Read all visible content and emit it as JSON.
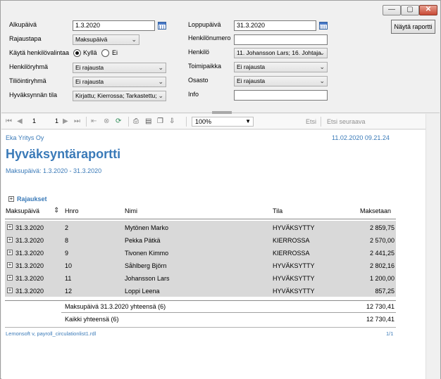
{
  "window": {
    "minimize_glyph": "—",
    "maximize_glyph": "▢",
    "close_glyph": "✕"
  },
  "params": {
    "alkupaiva_label": "Alkupäivä",
    "alkupaiva_value": "1.3.2020",
    "loppupaiva_label": "Loppupäivä",
    "loppupaiva_value": "31.3.2020",
    "rajaustapa_label": "Rajaustapa",
    "rajaustapa_value": "Maksupäivä",
    "henkilonumero_label": "Henkilönumero",
    "henkilonumero_value": "",
    "kayta_label": "Käytä henkilövalintaa",
    "kylla_label": "Kyllä",
    "ei_label": "Ei",
    "henkilo_label": "Henkilö",
    "henkilo_value": "11. Johansson Lars; 16. Johtaja",
    "henkiloryhma_label": "Henkilöryhmä",
    "henkiloryhma_value": "Ei rajausta",
    "toimipaikka_label": "Toimipaikka",
    "toimipaikka_value": "Ei rajausta",
    "tiliointiryhma_label": "Tiliöintiryhmä",
    "tiliointiryhma_value": "Ei rajausta",
    "osasto_label": "Osasto",
    "osasto_value": "Ei rajausta",
    "hyvaksynnan_label": "Hyväksynnän tila",
    "hyvaksynnan_value": "Kirjattu; Kierrossa; Tarkastettu;",
    "info_label": "Info",
    "info_value": "",
    "show_report_button": "Näytä raportti"
  },
  "toolbar": {
    "page_current": "1",
    "page_total": "1",
    "zoom": "100%",
    "find_label": "Etsi",
    "find_next_label": "Etsi seuraava"
  },
  "report": {
    "company": "Eka Yritys Oy",
    "timestamp": "11.02.2020 09.21.24",
    "title": "Hyväksyntäraportti",
    "subtitle": "Maksupäivä: 1.3.2020 - 31.3.2020",
    "rajaukset": "Rajaukset",
    "columns": {
      "maksupaiva": "Maksupäivä",
      "hnro": "Hnro",
      "nimi": "Nimi",
      "tila": "Tila",
      "maksetaan": "Maksetaan"
    },
    "rows": [
      {
        "date": "31.3.2020",
        "hnro": "2",
        "nimi": "Mytönen Marko",
        "tila": "HYVÄKSYTTY",
        "maksetaan": "2 859,75"
      },
      {
        "date": "31.3.2020",
        "hnro": "8",
        "nimi": "Pekka Pätkä",
        "tila": "KIERROSSA",
        "maksetaan": "2 570,00"
      },
      {
        "date": "31.3.2020",
        "hnro": "9",
        "nimi": "Tivonen Kimmo",
        "tila": "KIERROSSA",
        "maksetaan": "2 441,25"
      },
      {
        "date": "31.3.2020",
        "hnro": "10",
        "nimi": "Såhlberg Björn",
        "tila": "HYVÄKSYTTY",
        "maksetaan": "2 802,16"
      },
      {
        "date": "31.3.2020",
        "hnro": "11",
        "nimi": "Johansson Lars",
        "tila": "HYVÄKSYTTY",
        "maksetaan": "1 200,00"
      },
      {
        "date": "31.3.2020",
        "hnro": "12",
        "nimi": "Loppi Leena",
        "tila": "HYVÄKSYTTY",
        "maksetaan": "857,25"
      }
    ],
    "subtotal_label": "Maksupäivä 31.3.2020 yhteensä (6)",
    "subtotal_value": "12 730,41",
    "total_label": "Kaikki yhteensä (6)",
    "total_value": "12 730,41",
    "footer_left": "Lemonsoft v, payroll_circulationlist1.rdl",
    "footer_right": "1/1"
  },
  "colors": {
    "accent": "#3a7ab8",
    "band": "#d9d9d9"
  }
}
